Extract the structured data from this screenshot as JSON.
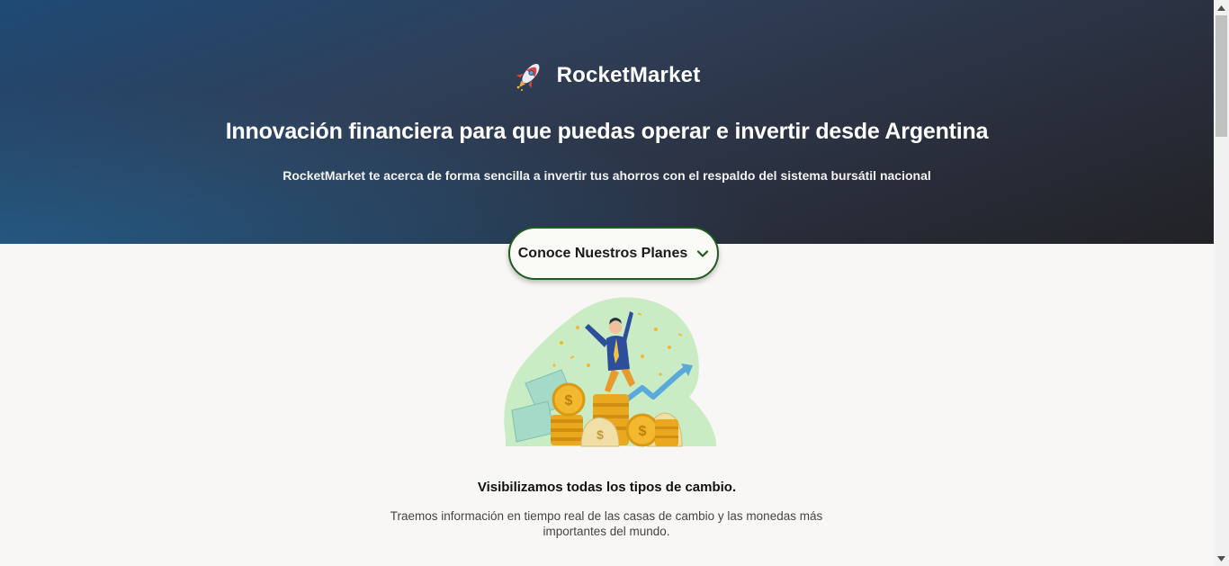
{
  "header": {
    "brand_name": "RocketMarket",
    "logo_icon": "rocket-icon",
    "title": "Innovación financiera para que puedas operar e invertir desde Argentina",
    "subtitle": "RocketMarket te acerca de forma sencilla a invertir tus ahorros con el respaldo del sistema bursátil nacional"
  },
  "plans_button": {
    "label": "Conoce Nuestros Planes",
    "icon": "chevron-down-icon"
  },
  "feature": {
    "illustration": "investor-celebrating-illustration",
    "title": "Visibilizamos todas los tipos de cambio.",
    "description": "Traemos información en tiempo real de las casas de cambio y las monedas más importantes del mundo."
  },
  "colors": {
    "hero_start": "#1f4a75",
    "hero_end": "#222226",
    "button_border": "#1f5c1f",
    "page_bg": "#f8f7f5"
  }
}
